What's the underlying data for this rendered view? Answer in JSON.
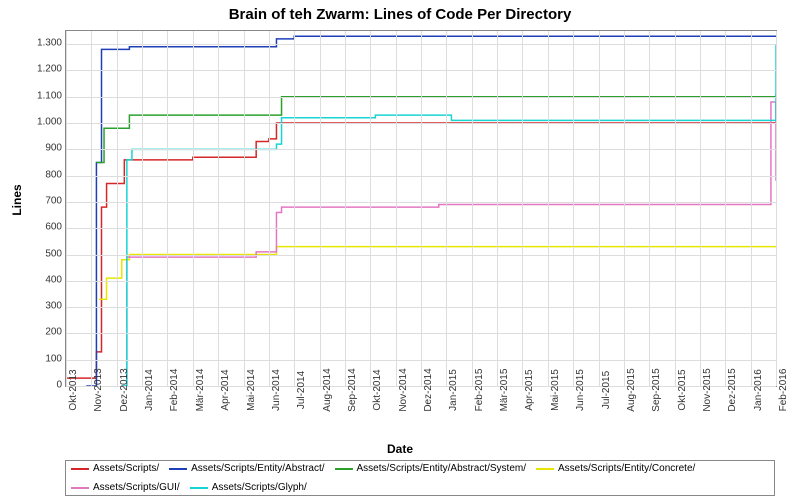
{
  "chart_data": {
    "type": "line",
    "title": "Brain of teh Zwarm: Lines of Code Per Directory",
    "xlabel": "Date",
    "ylabel": "Lines",
    "ylim": [
      0,
      1350
    ],
    "x_ticks": [
      "Okt-2013",
      "Nov-2013",
      "Dez-2013",
      "Jan-2014",
      "Feb-2014",
      "Mär-2014",
      "Apr-2014",
      "Mai-2014",
      "Jun-2014",
      "Jul-2014",
      "Aug-2014",
      "Sep-2014",
      "Okt-2014",
      "Nov-2014",
      "Dez-2014",
      "Jan-2015",
      "Feb-2015",
      "Mär-2015",
      "Apr-2015",
      "Mai-2015",
      "Jun-2015",
      "Jul-2015",
      "Aug-2015",
      "Sep-2015",
      "Okt-2015",
      "Nov-2015",
      "Dez-2015",
      "Jan-2016",
      "Feb-2016"
    ],
    "y_ticks": [
      0,
      100,
      200,
      300,
      400,
      500,
      600,
      700,
      800,
      900,
      "1.000",
      "1.100",
      "1.200",
      "1.300"
    ],
    "series": [
      {
        "name": "Assets/Scripts/",
        "color": "#d62728",
        "values": [
          [
            0,
            30
          ],
          [
            1,
            30
          ],
          [
            1.2,
            130
          ],
          [
            1.4,
            680
          ],
          [
            1.6,
            770
          ],
          [
            2.0,
            770
          ],
          [
            2.3,
            860
          ],
          [
            4.5,
            860
          ],
          [
            5,
            870
          ],
          [
            7.5,
            930
          ],
          [
            8,
            940
          ],
          [
            8.3,
            1000
          ],
          [
            27.5,
            1000
          ],
          [
            27.7,
            1000
          ],
          [
            28,
            1080
          ]
        ]
      },
      {
        "name": "Assets/Scripts/Entity/Abstract/",
        "color": "#1f3fb8",
        "values": [
          [
            0.8,
            0
          ],
          [
            1.2,
            850
          ],
          [
            1.4,
            1280
          ],
          [
            2.3,
            1280
          ],
          [
            2.5,
            1290
          ],
          [
            8,
            1290
          ],
          [
            8.3,
            1320
          ],
          [
            9,
            1330
          ],
          [
            28,
            1330
          ]
        ]
      },
      {
        "name": "Assets/Scripts/Entity/Abstract/System/",
        "color": "#2ca02c",
        "values": [
          [
            1.2,
            850
          ],
          [
            1.5,
            980
          ],
          [
            2.3,
            980
          ],
          [
            2.5,
            1030
          ],
          [
            8,
            1030
          ],
          [
            8.5,
            1100
          ],
          [
            9,
            1100
          ],
          [
            28,
            1100
          ],
          [
            28,
            1110
          ]
        ]
      },
      {
        "name": "Assets/Scripts/Entity/Concrete/",
        "color": "#e6e600",
        "values": [
          [
            1.3,
            330
          ],
          [
            1.6,
            410
          ],
          [
            2.2,
            480
          ],
          [
            2.5,
            500
          ],
          [
            8,
            500
          ],
          [
            8.3,
            530
          ],
          [
            28,
            530
          ]
        ]
      },
      {
        "name": "Assets/Scripts/GUI/",
        "color": "#e377c2",
        "values": [
          [
            2.2,
            0
          ],
          [
            2.4,
            490
          ],
          [
            7.3,
            490
          ],
          [
            7.5,
            510
          ],
          [
            8,
            510
          ],
          [
            8.3,
            660
          ],
          [
            8.5,
            680
          ],
          [
            14.5,
            680
          ],
          [
            14.7,
            690
          ],
          [
            27.7,
            690
          ],
          [
            27.8,
            1080
          ],
          [
            28,
            780
          ]
        ]
      },
      {
        "name": "Assets/Scripts/Glyph/",
        "color": "#17d4d4",
        "values": [
          [
            2.2,
            0
          ],
          [
            2.4,
            860
          ],
          [
            2.6,
            900
          ],
          [
            8,
            900
          ],
          [
            8.3,
            920
          ],
          [
            8.5,
            1020
          ],
          [
            12,
            1020
          ],
          [
            12.2,
            1030
          ],
          [
            15,
            1030
          ],
          [
            15.2,
            1010
          ],
          [
            27.8,
            1010
          ],
          [
            28,
            1240
          ],
          [
            28,
            1300
          ]
        ]
      }
    ]
  },
  "legend": {
    "items": [
      {
        "label": "Assets/Scripts/",
        "color": "#d62728"
      },
      {
        "label": "Assets/Scripts/Entity/Abstract/",
        "color": "#1f3fb8"
      },
      {
        "label": "Assets/Scripts/Entity/Abstract/System/",
        "color": "#2ca02c"
      },
      {
        "label": "Assets/Scripts/Entity/Concrete/",
        "color": "#e6e600"
      },
      {
        "label": "Assets/Scripts/GUI/",
        "color": "#e377c2"
      },
      {
        "label": "Assets/Scripts/Glyph/",
        "color": "#17d4d4"
      }
    ]
  }
}
